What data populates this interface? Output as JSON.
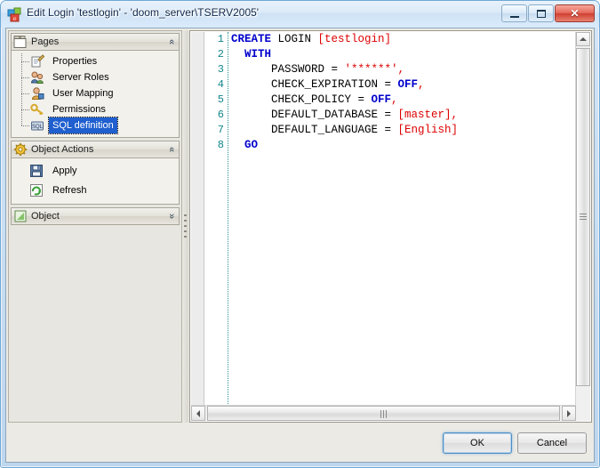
{
  "window": {
    "title": "Edit Login 'testlogin' - 'doom_server\\TSERV2005'",
    "icon": "app-icon",
    "controls": {
      "minimize": "Minimize",
      "maximize": "Maximize",
      "close": "Close",
      "close_glyph": "✕"
    }
  },
  "sidebar": {
    "panels": [
      {
        "title": "Pages",
        "icon": "pages-folder-icon",
        "collapsed": false,
        "chevron": "«",
        "items": [
          {
            "label": "Properties",
            "icon": "properties-icon",
            "selected": false
          },
          {
            "label": "Server Roles",
            "icon": "server-roles-icon",
            "selected": false
          },
          {
            "label": "User Mapping",
            "icon": "user-mapping-icon",
            "selected": false
          },
          {
            "label": "Permissions",
            "icon": "key-icon",
            "selected": false
          },
          {
            "label": "SQL definition",
            "icon": "sql-definition-icon",
            "selected": true
          }
        ]
      },
      {
        "title": "Object Actions",
        "icon": "gear-icon",
        "collapsed": false,
        "chevron": "«",
        "items": [
          {
            "label": "Apply",
            "icon": "save-floppy-icon"
          },
          {
            "label": "Refresh",
            "icon": "refresh-icon"
          }
        ]
      },
      {
        "title": "Object",
        "icon": "object-icon",
        "collapsed": true,
        "chevron": "»",
        "items": []
      }
    ]
  },
  "editor": {
    "line_numbers": [
      "1",
      "2",
      "3",
      "4",
      "5",
      "6",
      "7",
      "8"
    ],
    "lines": [
      [
        {
          "t": "kw",
          "v": "CREATE"
        },
        {
          "t": "id",
          "v": " LOGIN "
        },
        {
          "t": "br",
          "v": "[testlogin]"
        }
      ],
      [
        {
          "t": "id",
          "v": "  "
        },
        {
          "t": "kw",
          "v": "WITH"
        }
      ],
      [
        {
          "t": "id",
          "v": "      PASSWORD = "
        },
        {
          "t": "str",
          "v": "'******'"
        },
        {
          "t": "pn",
          "v": ","
        }
      ],
      [
        {
          "t": "id",
          "v": "      CHECK_EXPIRATION = "
        },
        {
          "t": "kw",
          "v": "OFF"
        },
        {
          "t": "pn",
          "v": ","
        }
      ],
      [
        {
          "t": "id",
          "v": "      CHECK_POLICY = "
        },
        {
          "t": "kw",
          "v": "OFF"
        },
        {
          "t": "pn",
          "v": ","
        }
      ],
      [
        {
          "t": "id",
          "v": "      DEFAULT_DATABASE = "
        },
        {
          "t": "br",
          "v": "[master]"
        },
        {
          "t": "pn",
          "v": ","
        }
      ],
      [
        {
          "t": "id",
          "v": "      DEFAULT_LANGUAGE = "
        },
        {
          "t": "br",
          "v": "[English]"
        }
      ],
      [
        {
          "t": "id",
          "v": "  "
        },
        {
          "t": "kw",
          "v": "GO"
        }
      ]
    ],
    "scroll": {
      "vertical_up_arrow": "▲",
      "horizontal_left_arrow": "◀",
      "horizontal_right_arrow": "▶"
    }
  },
  "footer": {
    "ok_label": "OK",
    "cancel_label": "Cancel"
  },
  "colors": {
    "keyword": "#0000cc",
    "identifier_bracket": "#dd0000",
    "string": "#dd0000",
    "line_number": "#13868c",
    "selection": "#1f5fcf",
    "close_button": "#cf3f32"
  }
}
